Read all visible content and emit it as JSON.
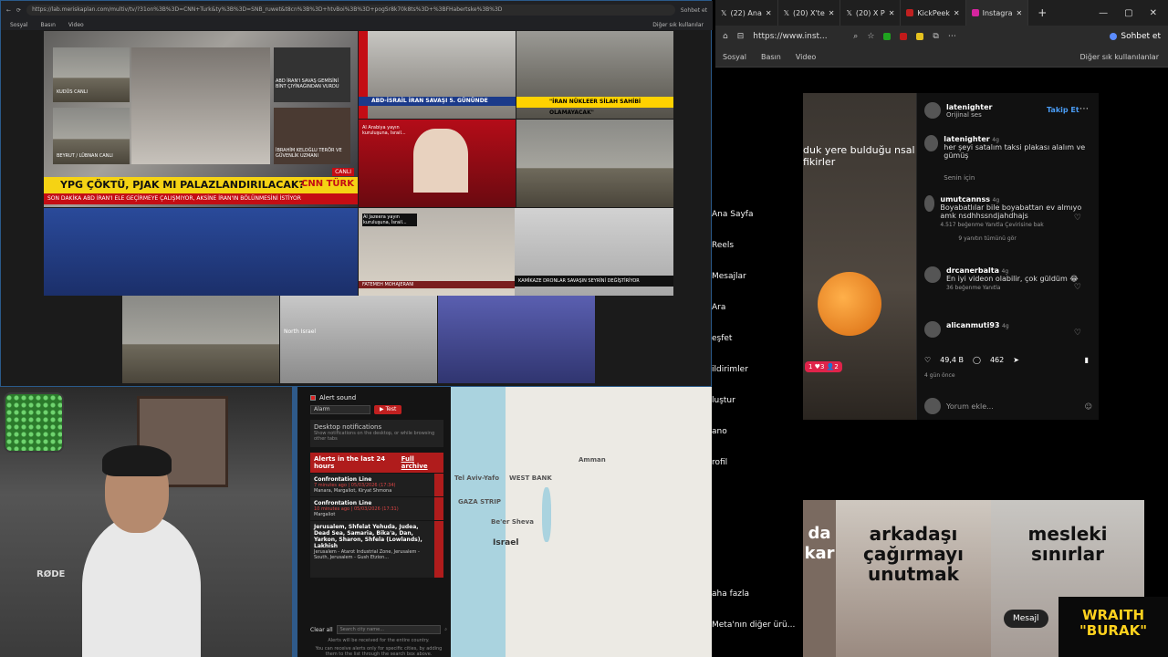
{
  "left_browser": {
    "url": "https://lab.meriskaplan.com/multiv/tv/?31on%3B%3D=CNN+Turk&ty%3B%3D=SNB_ruwet&t8cn%3B%3D+htvBoi%3B%3D+pogSr8k70k8ts%3D+%3BFHabertske%3B%3D",
    "sohbet": "Sohbet et",
    "other_bookmarks": "Diğer sık kullanılar",
    "bookmarks": [
      "Sosyal",
      "Basın",
      "Video"
    ]
  },
  "news": {
    "tile1_cities": [
      "KUDÜS CANLI",
      "BEYRUT / LÜBNAN CANLI"
    ],
    "tile1_caption": "ABD İRAN'I SAVAŞ GEMİSİNİ BİNT ÇIYİNAĞINDAN VURDU",
    "tile1_guest": "İBRAHİM KELOĞLU TERÖR VE GÜVENLİK UZMANI",
    "cnn_headline": "YPG ÇÖKTÜ, PJAK MI PALAZLANDIRILACAK?",
    "cnn_ticker": "SON DAKİKA  ABD İRAN'I ELE GEÇİRMEYE ÇALIŞMIYOR, AKSİNE İRAN'IN BÖLÜNMESİNİ İSTİYOR",
    "cnn_logo": "CNN TÜRK",
    "cnn_canli": "CANLI",
    "ntv_headline": "ABD-İSRAİL İRAN SAVAŞI 5. GÜNÜNDE",
    "ntv_son": "SON DAKİKA",
    "tr_headline": "\"İRAN NÜKLEER SİLAH SAHİBİ OLAMAYACAK\"",
    "arabiya_caption": "Al Arabiya yayın kuruluşuna, Israil...",
    "jazeera_caption": "Al Jazeera yayın kuruluşuna, İsrail...",
    "fatemeh_name": "FATEMEH MOHAJERANI",
    "kamikaze": "KAMİKAZE DRONLAR SAVAŞIN SEYRİNİ DEĞİŞTİRİYOR",
    "north_israel": "North Israel"
  },
  "alert_panel": {
    "alert_sound": "Alert sound",
    "alarm": "Alarm",
    "test": "▶ Test",
    "desktop_title": "Desktop notifications",
    "desktop_sub": "Show notifications on the desktop, or while browsing other tabs",
    "alerts_title": "Alerts in the last 24 hours",
    "full_archive": "Full archive",
    "items": [
      {
        "title": "Confrontation Line",
        "time": "7 minutes ago | 05/03/2026 (17:34)",
        "body": "Manara, Margaliot, Kiryat Shmona"
      },
      {
        "title": "Confrontation Line",
        "time": "10 minutes ago | 05/03/2026 (17:31)",
        "body": "Margaliot"
      },
      {
        "title": "Jerusalem, Shfelat Yehuda, Judea, Dead Sea, Samaria, Bika'a, Dan, Yarkon, Sharon, Shfela (Lowlands), Lakhish",
        "time": "",
        "body": "Jerusalem - Atarot Industrial Zone, Jerusalem - South, Jerusalem - Gush Etzion..."
      }
    ],
    "clear_all": "Clear all",
    "search_placeholder": "Search city name...",
    "footer1": "Alerts will be received for the entire country.",
    "footer2": "You can receive alerts only for specific cities, by adding them to the list through the search box above."
  },
  "map_labels": {
    "tel_aviv": "Tel Aviv-Yafo",
    "amman": "Amman",
    "west_bank": "WEST BANK",
    "gaza": "GAZA STRIP",
    "beer_sheva": "Be'er Sheva",
    "israel": "Israel"
  },
  "webcam": {
    "rode": "RØDE"
  },
  "right_tabs": [
    {
      "label": "(22) Ana"
    },
    {
      "label": "(20) X'te"
    },
    {
      "label": "(20) X P"
    },
    {
      "label": "KickPeek"
    },
    {
      "label": "Instagra"
    }
  ],
  "right_browser": {
    "url": "https://www.inst...",
    "sohbet": "Sohbet et",
    "bookmarks": [
      "Sosyal",
      "Basın",
      "Video"
    ],
    "other_bookmarks": "Diğer sık kullanılanlar"
  },
  "insta_nav": [
    "Ana Sayfa",
    "Reels",
    "Mesajlar",
    "Ara",
    "Keşfet",
    "Bildirimler",
    "Oluştur",
    "Profil",
    "Daha fazla",
    "Meta'nın diğer ürü..."
  ],
  "insta_nav_partial": [
    "Ana Sayfa",
    "Reels",
    "Mesajlar",
    "Ara",
    "eşfet",
    "ildirimler",
    "luştur",
    "ano",
    "rofil",
    "aha fazla",
    "Meta'nın diğer ürü..."
  ],
  "reel": {
    "caption": "duk yere bulduğu nsal fikirler",
    "badge": "1 ♥3 👤2"
  },
  "post": {
    "author": "latenighter",
    "audio": "Orijinal ses",
    "follow": "Takip Et",
    "main_user": "latenighter",
    "main_time": "4g",
    "main_text": "her şeyi satalım taksi plakası alalım ve gümüş",
    "senin_icin": "Senin için",
    "comments": [
      {
        "user": "umutcannss",
        "time": "4g",
        "text": "Boyabatlılar bile boyabattan ev almıyo amk nsdhhssndjahdhajs",
        "meta": "4.517 beğenme   Yanıtla   Çevirisine bak",
        "replies": "9 yanıtın tümünü gör"
      },
      {
        "user": "drcanerbalta",
        "time": "4g",
        "text": "En iyi videon olabilir, çok güldüm 😂",
        "meta": "36 beğenme   Yanıtla"
      },
      {
        "user": "alicanmuti93",
        "time": "4g",
        "text": "",
        "meta": ""
      }
    ],
    "likes": "49,4 B",
    "comments_count": "462",
    "time": "4 gün önce",
    "add_comment": "Yorum ekle..."
  },
  "thumbs": {
    "a": "da kar",
    "b": "arkadaşı çağırmayı unutmak",
    "c": "mesleki sınırlar"
  },
  "mesaj_button": "Mesajl",
  "overlay": {
    "line1": "WRAITH",
    "line2": "\"BURAK\""
  }
}
